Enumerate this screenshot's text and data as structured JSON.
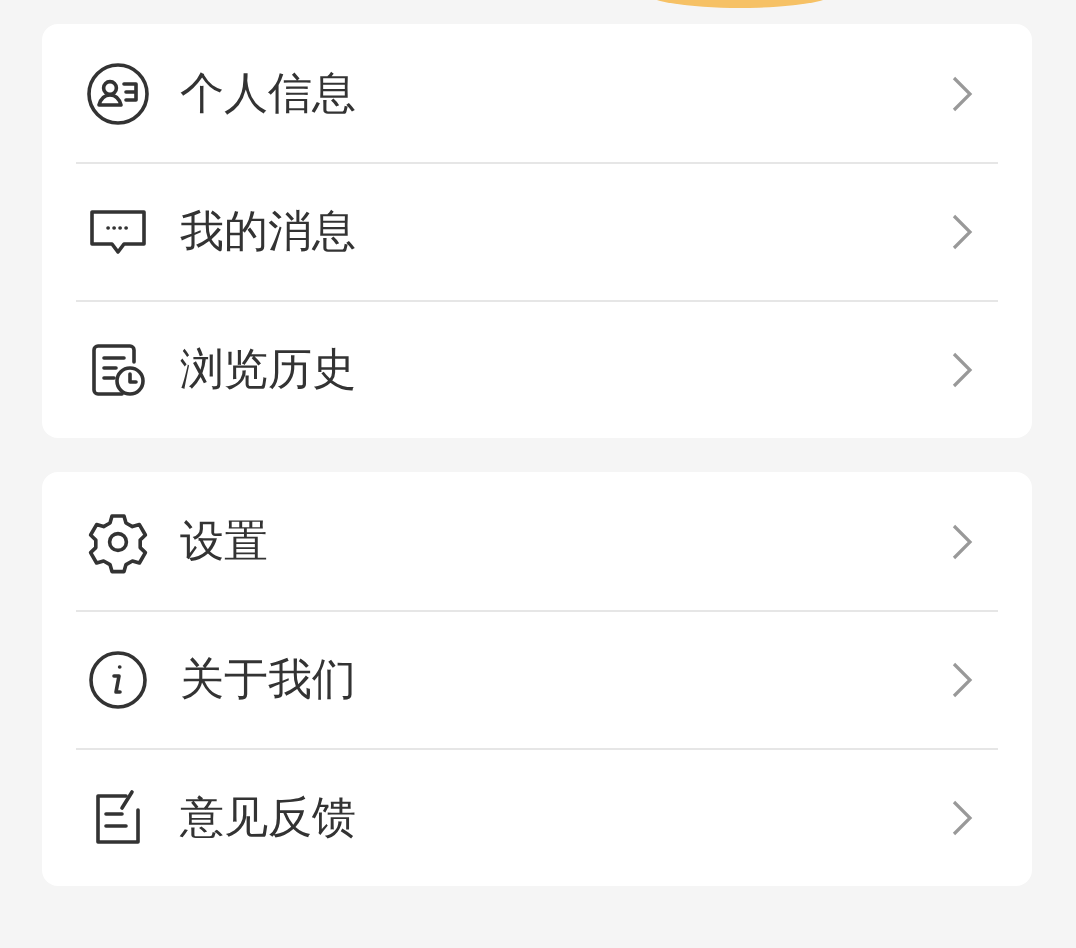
{
  "groups": [
    {
      "items": [
        {
          "label": "个人信息"
        },
        {
          "label": "我的消息"
        },
        {
          "label": "浏览历史"
        }
      ]
    },
    {
      "items": [
        {
          "label": "设置"
        },
        {
          "label": "关于我们"
        },
        {
          "label": "意见反馈"
        }
      ]
    }
  ]
}
